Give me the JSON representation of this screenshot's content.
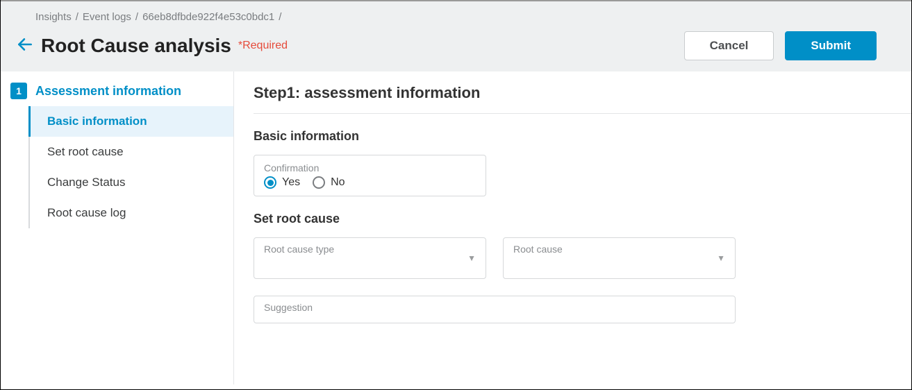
{
  "breadcrumbs": [
    "Insights",
    "Event logs",
    "66eb8dfbde922f4e53c0bdc1"
  ],
  "page": {
    "title": "Root Cause analysis",
    "required_note": "*Required",
    "cancel": "Cancel",
    "submit": "Submit"
  },
  "sidebar": {
    "step_number": "1",
    "step_label": "Assessment information",
    "items": [
      {
        "label": "Basic information",
        "active": true
      },
      {
        "label": "Set root cause",
        "active": false
      },
      {
        "label": "Change Status",
        "active": false
      },
      {
        "label": "Root cause log",
        "active": false
      }
    ]
  },
  "content": {
    "heading": "Step1: assessment information",
    "basic_info_title": "Basic information",
    "confirmation": {
      "label": "Confirmation",
      "yes": "Yes",
      "no": "No",
      "selected": "yes"
    },
    "set_root_cause_title": "Set root cause",
    "root_cause_type_label": "Root cause type",
    "root_cause_label": "Root cause",
    "suggestion_label": "Suggestion"
  }
}
